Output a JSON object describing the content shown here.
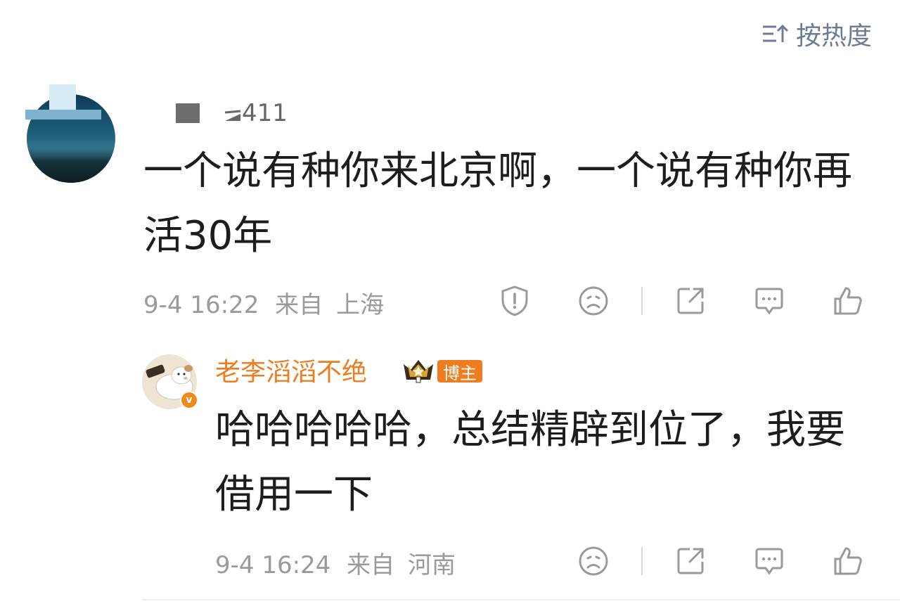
{
  "sort": {
    "label": "按热度",
    "icon": "sort-by-heat-icon"
  },
  "comments": [
    {
      "username": "411",
      "text": "一个说有种你来北京啊，一个说有种你再活30年",
      "time": "9-4 16:22",
      "source_prefix": "来自",
      "location": "上海"
    }
  ],
  "reply": {
    "username": "老李滔滔不绝",
    "badge": "博主",
    "text": "哈哈哈哈哈，总结精辟到位了，我要借用一下",
    "time": "9-4 16:24",
    "source_prefix": "来自",
    "location": "河南"
  },
  "colors": {
    "accent_orange": "#ef7d1e",
    "meta_gray": "#9a9a9a",
    "sort_blue": "#6d7c96"
  },
  "icons": [
    "report-icon",
    "dislike-icon",
    "share-icon",
    "comment-icon",
    "like-icon",
    "verified-v-icon",
    "crown-icon"
  ]
}
